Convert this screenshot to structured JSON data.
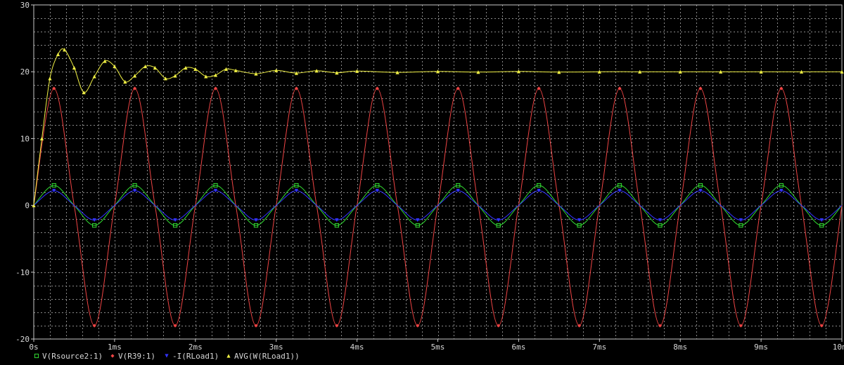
{
  "chart_data": {
    "type": "line",
    "title": "",
    "xlabel": "",
    "ylabel": "",
    "xlim": [
      0,
      10
    ],
    "ylim": [
      -20,
      30
    ],
    "x_unit": "ms",
    "grid": true,
    "legend_placement": "bottom-left",
    "x_ticks": [
      "0s",
      "1ms",
      "2ms",
      "3ms",
      "4ms",
      "5ms",
      "6ms",
      "7ms",
      "8ms",
      "9ms",
      "10ms"
    ],
    "y_ticks": [
      "30",
      "20",
      "10",
      "0",
      "-10",
      "-20"
    ],
    "series": [
      {
        "name": "V(Rsource2:1)",
        "color": "#33dd33",
        "marker": "square",
        "x": [
          0,
          0.25,
          0.5,
          0.75,
          1,
          1.25,
          1.5,
          1.75,
          2,
          2.25,
          2.5,
          2.75,
          3,
          3.25,
          3.5,
          3.75,
          4,
          4.25,
          4.5,
          4.75,
          5,
          5.25,
          5.5,
          5.75,
          6,
          6.25,
          6.5,
          6.75,
          7,
          7.25,
          7.5,
          7.75,
          8,
          8.25,
          8.5,
          8.75,
          9,
          9.25,
          9.5,
          9.75,
          10
        ],
        "values": [
          0,
          3,
          0,
          -3,
          0,
          3,
          0,
          -3,
          0,
          3,
          0,
          -3,
          0,
          3,
          0,
          -3,
          0,
          3,
          0,
          -3,
          0,
          3,
          0,
          -3,
          0,
          3,
          0,
          -3,
          0,
          3,
          0,
          -3,
          0,
          3,
          0,
          -3,
          0,
          3,
          0,
          -3,
          0
        ]
      },
      {
        "name": "V(R39:1)",
        "color": "#ee4444",
        "marker": "diamond",
        "x": [
          0,
          0.25,
          0.5,
          0.75,
          1,
          1.25,
          1.5,
          1.75,
          2,
          2.25,
          2.5,
          2.75,
          3,
          3.25,
          3.5,
          3.75,
          4,
          4.25,
          4.5,
          4.75,
          5,
          5.25,
          5.5,
          5.75,
          6,
          6.25,
          6.5,
          6.75,
          7,
          7.25,
          7.5,
          7.75,
          8,
          8.25,
          8.5,
          8.75,
          9,
          9.25,
          9.5,
          9.75,
          10
        ],
        "values": [
          0,
          17.5,
          0,
          -18,
          0,
          17.5,
          0,
          -18,
          0,
          17.5,
          0,
          -18,
          0,
          17.5,
          0,
          -18,
          0,
          17.5,
          0,
          -18,
          0,
          17.5,
          0,
          -18,
          0,
          17.5,
          0,
          -18,
          0,
          17.5,
          0,
          -18,
          0,
          17.5,
          0,
          -18,
          0,
          17.5,
          0,
          -18,
          0
        ]
      },
      {
        "name": "-I(RLoad1)",
        "color": "#3333ff",
        "marker": "triangle-down",
        "x": [
          0,
          0.25,
          0.5,
          0.75,
          1,
          1.25,
          1.5,
          1.75,
          2,
          2.25,
          2.5,
          2.75,
          3,
          3.25,
          3.5,
          3.75,
          4,
          4.25,
          4.5,
          4.75,
          5,
          5.25,
          5.5,
          5.75,
          6,
          6.25,
          6.5,
          6.75,
          7,
          7.25,
          7.5,
          7.75,
          8,
          8.25,
          8.5,
          8.75,
          9,
          9.25,
          9.5,
          9.75,
          10
        ],
        "values": [
          0,
          2.2,
          0,
          -2.2,
          0,
          2.2,
          0,
          -2.2,
          0,
          2.2,
          0,
          -2.2,
          0,
          2.2,
          0,
          -2.2,
          0,
          2.2,
          0,
          -2.2,
          0,
          2.2,
          0,
          -2.2,
          0,
          2.2,
          0,
          -2.2,
          0,
          2.2,
          0,
          -2.2,
          0,
          2.2,
          0,
          -2.2,
          0,
          2.2,
          0,
          -2.2,
          0
        ]
      },
      {
        "name": "AVG(W(RLoad1))",
        "color": "#eeee44",
        "marker": "triangle-up",
        "x": [
          0,
          0.1,
          0.2,
          0.3,
          0.38,
          0.5,
          0.62,
          0.75,
          0.88,
          1.0,
          1.13,
          1.25,
          1.38,
          1.5,
          1.63,
          1.75,
          1.88,
          2.0,
          2.13,
          2.25,
          2.38,
          2.5,
          2.75,
          3.0,
          3.25,
          3.5,
          3.75,
          4.0,
          4.5,
          5.0,
          5.5,
          6.0,
          6.5,
          7.0,
          7.5,
          8.0,
          8.5,
          9.0,
          9.5,
          10.0
        ],
        "values": [
          0,
          10,
          19,
          22.6,
          23.3,
          20.6,
          16.9,
          19.3,
          21.6,
          20.8,
          18.5,
          19.4,
          20.8,
          20.6,
          19.0,
          19.4,
          20.6,
          20.4,
          19.3,
          19.5,
          20.4,
          20.2,
          19.7,
          20.2,
          19.8,
          20.15,
          19.85,
          20.1,
          19.9,
          20.05,
          19.95,
          20.05,
          19.95,
          20.0,
          20.0,
          20.0,
          20.0,
          20.0,
          20.0,
          20.0
        ]
      }
    ]
  }
}
